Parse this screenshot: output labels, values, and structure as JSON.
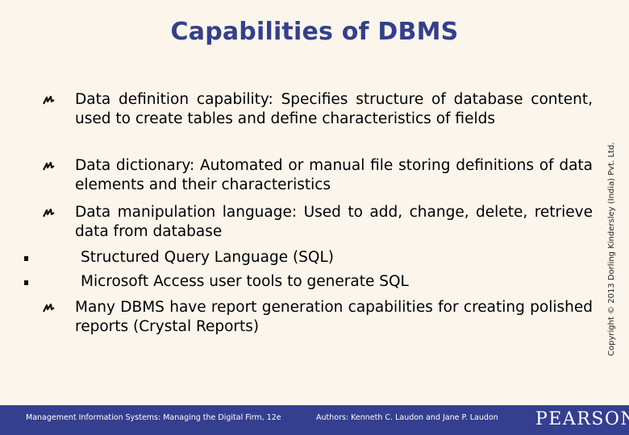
{
  "slide": {
    "title": "Capabilities of DBMS",
    "bullets": [
      {
        "text": "Data definition capability: Specifies structure of database content, used to create tables and define characteristics of fields"
      },
      {
        "text": "Data dictionary: Automated or manual file storing definitions of data elements and their characteristics"
      },
      {
        "text": "Data manipulation language: Used to add, change, delete, retrieve data from database"
      },
      {
        "text": "Many DBMS have report generation capabilities for creating polished reports (Crystal Reports)"
      }
    ],
    "sub_bullets": [
      {
        "text": "Structured Query Language (SQL)"
      },
      {
        "text": "Microsoft Access user tools to generate SQL"
      }
    ],
    "bullet_icon": "curly-arrow-bullet-icon",
    "sub_bullet_icon": "square-bullet-icon"
  },
  "copyright": "Copyright © 2013 Dorling Kindersley (India) Pvt. Ltd.",
  "footer": {
    "book": "Management Information Systems: Managing the Digital Firm, 12e",
    "authors": "Authors: Kenneth C. Laudon and Jane P. Laudon",
    "logo": "PEARSON"
  },
  "colors": {
    "title": "#33408b",
    "footer_bg": "#343f8f",
    "background": "#fbf5ec"
  }
}
